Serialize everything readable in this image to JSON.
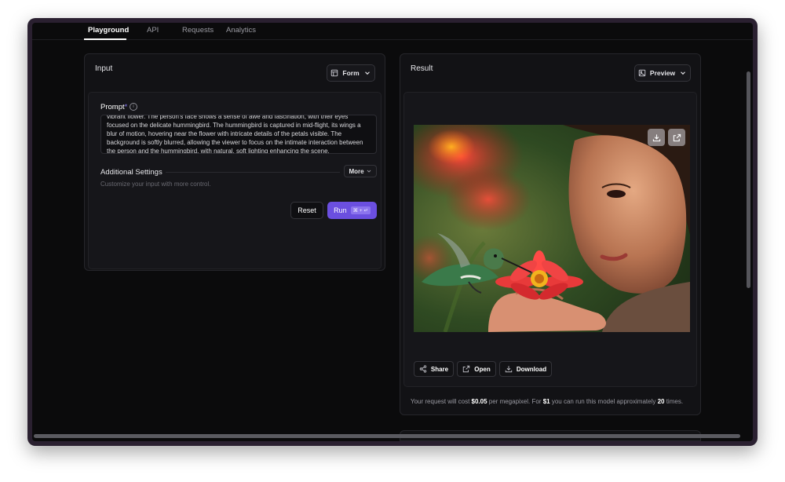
{
  "nav": {
    "tabs": [
      {
        "label": "Playground",
        "active": true
      },
      {
        "label": "API",
        "active": false
      },
      {
        "label": "Requests",
        "active": false
      },
      {
        "label": "Analytics",
        "active": false
      }
    ]
  },
  "input_panel": {
    "title": "Input",
    "mode_button": "Form",
    "prompt_label": "Prompt",
    "prompt_required_mark": "*",
    "info_glyph": "i",
    "prompt_value": "vibrant flower. The person's face shows a sense of awe and fascination, with their eyes focused on the delicate hummingbird. The hummingbird is captured in mid-flight, its wings a blur of motion, hovering near the flower with intricate details of the petals visible. The background is softly blurred, allowing the viewer to focus on the intimate interaction between the person and the hummingbird, with natural, soft lighting enhancing the scene.",
    "additional_settings_title": "Additional Settings",
    "additional_settings_subtitle": "Customize your input with more control.",
    "more_button": "More",
    "reset_button": "Reset",
    "run_button": "Run",
    "run_shortcut": "⌘ + ↵"
  },
  "result_panel": {
    "title": "Result",
    "mode_button": "Preview",
    "share_button": "Share",
    "open_button": "Open",
    "download_button": "Download",
    "cost_parts": {
      "p1": "Your request will cost ",
      "price": "$0.05",
      "p2": " per megapixel. For ",
      "budget": "$1",
      "p3": " you can run this model approximately ",
      "count": "20",
      "p4": " times."
    }
  },
  "colors": {
    "accent": "#6b4fe0",
    "background": "#0b0b0c",
    "panel": "#121215"
  },
  "icons": {
    "form": "form-layout-icon",
    "preview": "image-preview-icon",
    "chevron": "chevron-down-icon",
    "image_download": "download-icon",
    "image_open": "external-link-icon",
    "share": "share-icon",
    "open": "external-link-icon",
    "download": "download-icon"
  }
}
